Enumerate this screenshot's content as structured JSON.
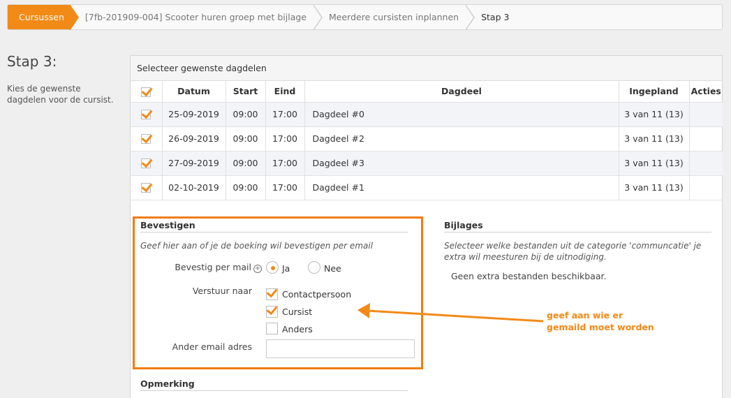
{
  "breadcrumb": [
    "Cursussen",
    "[7fb-201909-004] Scooter huren groep met bijlage",
    "Meerdere cursisten inplannen",
    "Stap 3"
  ],
  "step": {
    "title": "Stap 3:",
    "description": "Kies de gewenste dagdelen voor de cursist."
  },
  "panel": {
    "title": "Selecteer gewenste dagdelen",
    "columns": [
      "Datum",
      "Start",
      "Eind",
      "Dagdeel",
      "Ingepland",
      "Acties"
    ],
    "rows": [
      {
        "datum": "25-09-2019",
        "start": "09:00",
        "eind": "17:00",
        "dagdeel": "Dagdeel #0",
        "ingepland": "3 van 11 (13)"
      },
      {
        "datum": "26-09-2019",
        "start": "09:00",
        "eind": "17:00",
        "dagdeel": "Dagdeel #2",
        "ingepland": "3 van 11 (13)"
      },
      {
        "datum": "27-09-2019",
        "start": "09:00",
        "eind": "17:00",
        "dagdeel": "Dagdeel #3",
        "ingepland": "3 van 11 (13)"
      },
      {
        "datum": "02-10-2019",
        "start": "09:00",
        "eind": "17:00",
        "dagdeel": "Dagdeel #1",
        "ingepland": "3 van 11 (13)"
      }
    ]
  },
  "bevestigen": {
    "title": "Bevestigen",
    "hint": "Geef hier aan of je de boeking wil bevestigen per email",
    "confirm_label": "Bevestig per mail",
    "confirm_icon": "plus-circle-icon",
    "option_yes": "Ja",
    "option_no": "Nee",
    "send_to_label": "Verstuur naar",
    "recipients": [
      {
        "label": "Contactpersoon",
        "checked": true
      },
      {
        "label": "Cursist",
        "checked": true
      },
      {
        "label": "Anders",
        "checked": false
      }
    ],
    "other_email_label": "Ander email adres",
    "other_email_value": ""
  },
  "bijlages": {
    "title": "Bijlages",
    "hint": "Selecteer welke bestanden uit de categorie 'communcatie' je extra wil meesturen bij de uitnodiging.",
    "empty": "Geen extra bestanden beschikbaar."
  },
  "opmerking": {
    "title": "Opmerking"
  },
  "annotation": {
    "line1": "geef aan wie er",
    "line2": "gemaild moet worden",
    "color": "#f28a17"
  }
}
